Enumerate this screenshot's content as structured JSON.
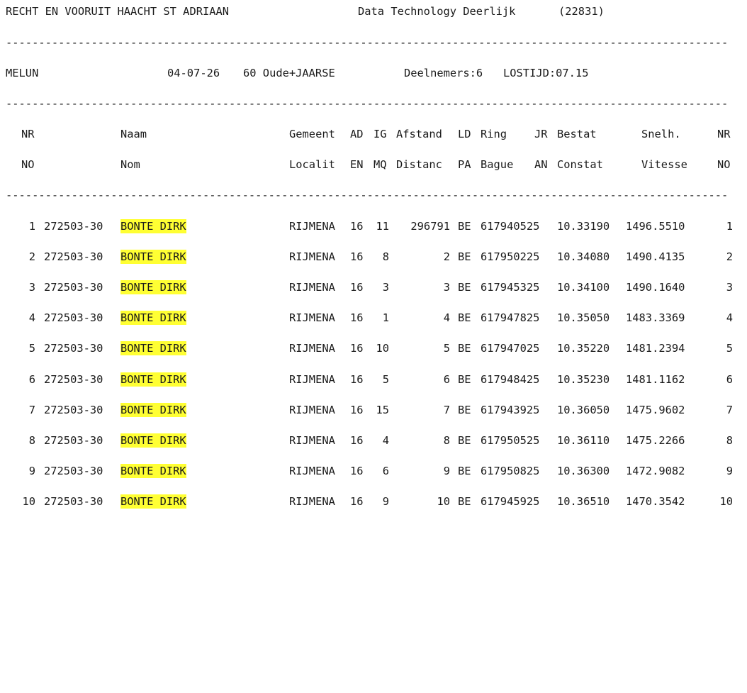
{
  "report": {
    "club": "RECHT EN VOORUIT HAACHT ST ADRIAAN",
    "software": "Data Technology Deerlijk",
    "code": "(22831)",
    "race": {
      "place": "MELUN",
      "date": "04-07-26",
      "category": "60 Oude+JAARSE",
      "participants": "Deelnemers:6",
      "release": "LOSTIJD:07.15"
    },
    "separator": "--------------------------------------------------------------------------------------------------------------"
  },
  "columns_nl": {
    "nr": "NR",
    "naam": "Naam",
    "gemeente": "Gemeent",
    "ad": "AD",
    "ig": "IG",
    "afstand": "Afstand",
    "ld": "LD",
    "ring": "Ring",
    "jr": "JR",
    "bestat": "Bestat",
    "snelh": "Snelh.",
    "nr2": "NR"
  },
  "columns_fr": {
    "nr": "NO",
    "naam": "Nom",
    "gemeente": "Localit",
    "ad": "EN",
    "ig": "MQ",
    "afstand": "Distanc",
    "ld": "PA",
    "ring": "Bague",
    "jr": "AN",
    "bestat": "Constat",
    "snelh": "Vitesse",
    "nr2": "NO"
  },
  "rows": [
    {
      "nr": "1",
      "lid": "272503-30",
      "naam": "BONTE DIRK",
      "gemeente": "RIJMENA",
      "ad": "16",
      "ig": "11",
      "afstand": "296791",
      "ld": "BE",
      "ring": "617940525",
      "bestat": "10.33190",
      "snelh": "1496.5510",
      "nr2": "1"
    },
    {
      "nr": "2",
      "lid": "272503-30",
      "naam": "BONTE DIRK",
      "gemeente": "RIJMENA",
      "ad": "16",
      "ig": "8",
      "afstand": "2",
      "ld": "BE",
      "ring": "617950225",
      "bestat": "10.34080",
      "snelh": "1490.4135",
      "nr2": "2"
    },
    {
      "nr": "3",
      "lid": "272503-30",
      "naam": "BONTE DIRK",
      "gemeente": "RIJMENA",
      "ad": "16",
      "ig": "3",
      "afstand": "3",
      "ld": "BE",
      "ring": "617945325",
      "bestat": "10.34100",
      "snelh": "1490.1640",
      "nr2": "3"
    },
    {
      "nr": "4",
      "lid": "272503-30",
      "naam": "BONTE DIRK",
      "gemeente": "RIJMENA",
      "ad": "16",
      "ig": "1",
      "afstand": "4",
      "ld": "BE",
      "ring": "617947825",
      "bestat": "10.35050",
      "snelh": "1483.3369",
      "nr2": "4"
    },
    {
      "nr": "5",
      "lid": "272503-30",
      "naam": "BONTE DIRK",
      "gemeente": "RIJMENA",
      "ad": "16",
      "ig": "10",
      "afstand": "5",
      "ld": "BE",
      "ring": "617947025",
      "bestat": "10.35220",
      "snelh": "1481.2394",
      "nr2": "5"
    },
    {
      "nr": "6",
      "lid": "272503-30",
      "naam": "BONTE DIRK",
      "gemeente": "RIJMENA",
      "ad": "16",
      "ig": "5",
      "afstand": "6",
      "ld": "BE",
      "ring": "617948425",
      "bestat": "10.35230",
      "snelh": "1481.1162",
      "nr2": "6"
    },
    {
      "nr": "7",
      "lid": "272503-30",
      "naam": "BONTE DIRK",
      "gemeente": "RIJMENA",
      "ad": "16",
      "ig": "15",
      "afstand": "7",
      "ld": "BE",
      "ring": "617943925",
      "bestat": "10.36050",
      "snelh": "1475.9602",
      "nr2": "7"
    },
    {
      "nr": "8",
      "lid": "272503-30",
      "naam": "BONTE DIRK",
      "gemeente": "RIJMENA",
      "ad": "16",
      "ig": "4",
      "afstand": "8",
      "ld": "BE",
      "ring": "617950525",
      "bestat": "10.36110",
      "snelh": "1475.2266",
      "nr2": "8"
    },
    {
      "nr": "9",
      "lid": "272503-30",
      "naam": "BONTE DIRK",
      "gemeente": "RIJMENA",
      "ad": "16",
      "ig": "6",
      "afstand": "9",
      "ld": "BE",
      "ring": "617950825",
      "bestat": "10.36300",
      "snelh": "1472.9082",
      "nr2": "9"
    },
    {
      "nr": "10",
      "lid": "272503-30",
      "naam": "BONTE DIRK",
      "gemeente": "RIJMENA",
      "ad": "16",
      "ig": "9",
      "afstand": "10",
      "ld": "BE",
      "ring": "617945925",
      "bestat": "10.36510",
      "snelh": "1470.3542",
      "nr2": "10"
    }
  ],
  "colors": {
    "text": "#1a1a1a",
    "highlight": "#ffff33",
    "background": "#ffffff"
  }
}
